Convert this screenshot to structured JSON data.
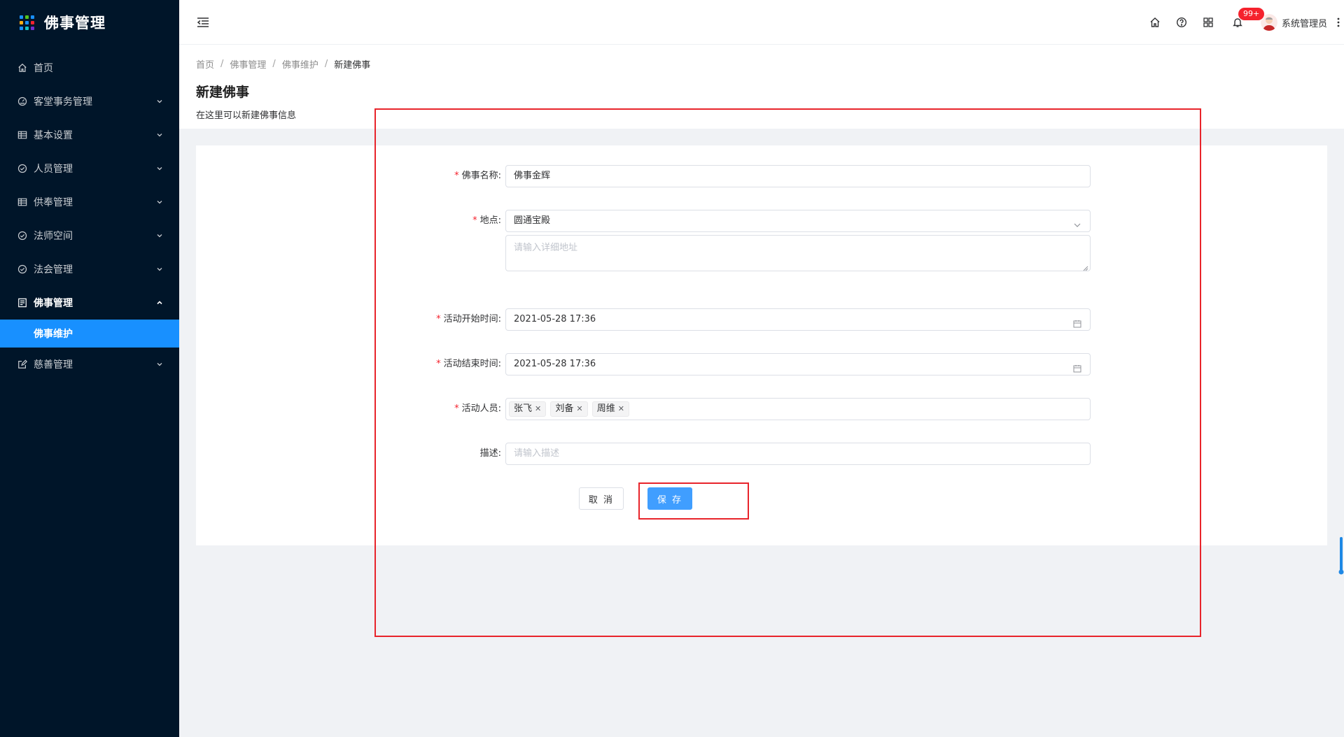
{
  "app": {
    "title": "佛事管理"
  },
  "sidebar": {
    "items": [
      {
        "label": "首页",
        "icon": "home-icon",
        "expandable": false
      },
      {
        "label": "客堂事务管理",
        "icon": "dashboard-icon",
        "expandable": true
      },
      {
        "label": "基本设置",
        "icon": "table-icon",
        "expandable": true
      },
      {
        "label": "人员管理",
        "icon": "check-circle-icon",
        "expandable": true
      },
      {
        "label": "供奉管理",
        "icon": "table-icon",
        "expandable": true
      },
      {
        "label": "法师空间",
        "icon": "check-circle-icon",
        "expandable": true
      },
      {
        "label": "法会管理",
        "icon": "check-circle-icon",
        "expandable": true
      },
      {
        "label": "佛事管理",
        "icon": "profile-icon",
        "expandable": true,
        "open": true
      },
      {
        "label": "慈善管理",
        "icon": "form-icon",
        "expandable": true
      }
    ],
    "active_sub": "佛事维护"
  },
  "header": {
    "badge": "99+",
    "username": "系统管理员"
  },
  "breadcrumb": [
    "首页",
    "佛事管理",
    "佛事维护",
    "新建佛事"
  ],
  "page": {
    "title": "新建佛事",
    "description": "在这里可以新建佛事信息"
  },
  "form": {
    "name": {
      "label": "佛事名称:",
      "value": "佛事金辉",
      "required": true
    },
    "location": {
      "label": "地点:",
      "value": "圆通宝殿",
      "required": true,
      "detail_placeholder": "请输入详细地址"
    },
    "start_time": {
      "label": "活动开始时间:",
      "value": "2021-05-28 17:36",
      "required": true
    },
    "end_time": {
      "label": "活动结束时间:",
      "value": "2021-05-28 17:36",
      "required": true
    },
    "people": {
      "label": "活动人员:",
      "required": true,
      "tags": [
        "张飞",
        "刘备",
        "周维"
      ]
    },
    "description": {
      "label": "描述:",
      "placeholder": "请输入描述",
      "required": false
    },
    "cancel_label": "取 消",
    "save_label": "保 存"
  },
  "colors": {
    "sidebar_bg": "#001529",
    "active_menu": "#1890ff",
    "primary_button": "#409eff",
    "required_mark": "#f5222d",
    "annotation": "#e8242b"
  }
}
